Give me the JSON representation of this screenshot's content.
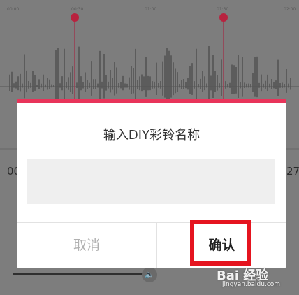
{
  "timeline": {
    "ticks": [
      "00:00",
      "00:30",
      "01:00",
      "01:30",
      "02:00"
    ]
  },
  "editor": {
    "left_time": "00",
    "right_time": "27"
  },
  "dialog": {
    "title": "输入DIY彩铃名称",
    "input_value": "",
    "cancel_label": "取消",
    "confirm_label": "确认"
  },
  "watermark": {
    "brand": "Bai 经验",
    "url": "jingyan.baidu.com"
  },
  "colors": {
    "accent": "#e8345a",
    "highlight": "#e5141f",
    "overlay": "#7d7d7d"
  }
}
